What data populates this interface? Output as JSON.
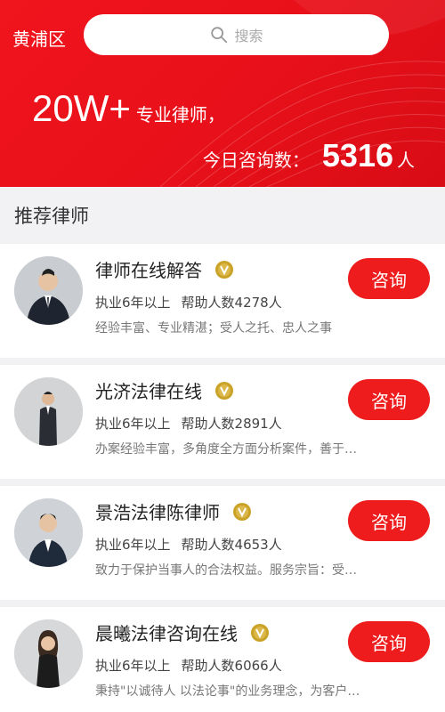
{
  "header": {
    "city": "黄浦区",
    "search_placeholder": "搜索",
    "headline_big": "20W+",
    "headline_small": "专业律师，",
    "consult_label": "今日咨询数：",
    "consult_count": "5316",
    "consult_unit": "人"
  },
  "section": {
    "title": "推荐律师"
  },
  "colors": {
    "brand_red": "#ee1c1c",
    "badge_gold": "#c9a227"
  },
  "lawyers": [
    {
      "name": "律师在线解答",
      "years": "执业6年以上",
      "helped": "帮助人数4278人",
      "desc": "经验丰富、专业精湛；受人之托、忠人之事",
      "button": "咨询"
    },
    {
      "name": "光济法律在线",
      "years": "执业6年以上",
      "helped": "帮助人数2891人",
      "desc": "办案经验丰富，多角度全方面分析案件，善于…",
      "button": "咨询"
    },
    {
      "name": "景浩法律陈律师",
      "years": "执业6年以上",
      "helped": "帮助人数4653人",
      "desc": "致力于保护当事人的合法权益。服务宗旨：受…",
      "button": "咨询"
    },
    {
      "name": "晨曦法律咨询在线",
      "years": "执业6年以上",
      "helped": "帮助人数6066人",
      "desc": "秉持\"以诚待人 以法论事\"的业务理念，为客户…",
      "button": "咨询"
    }
  ]
}
